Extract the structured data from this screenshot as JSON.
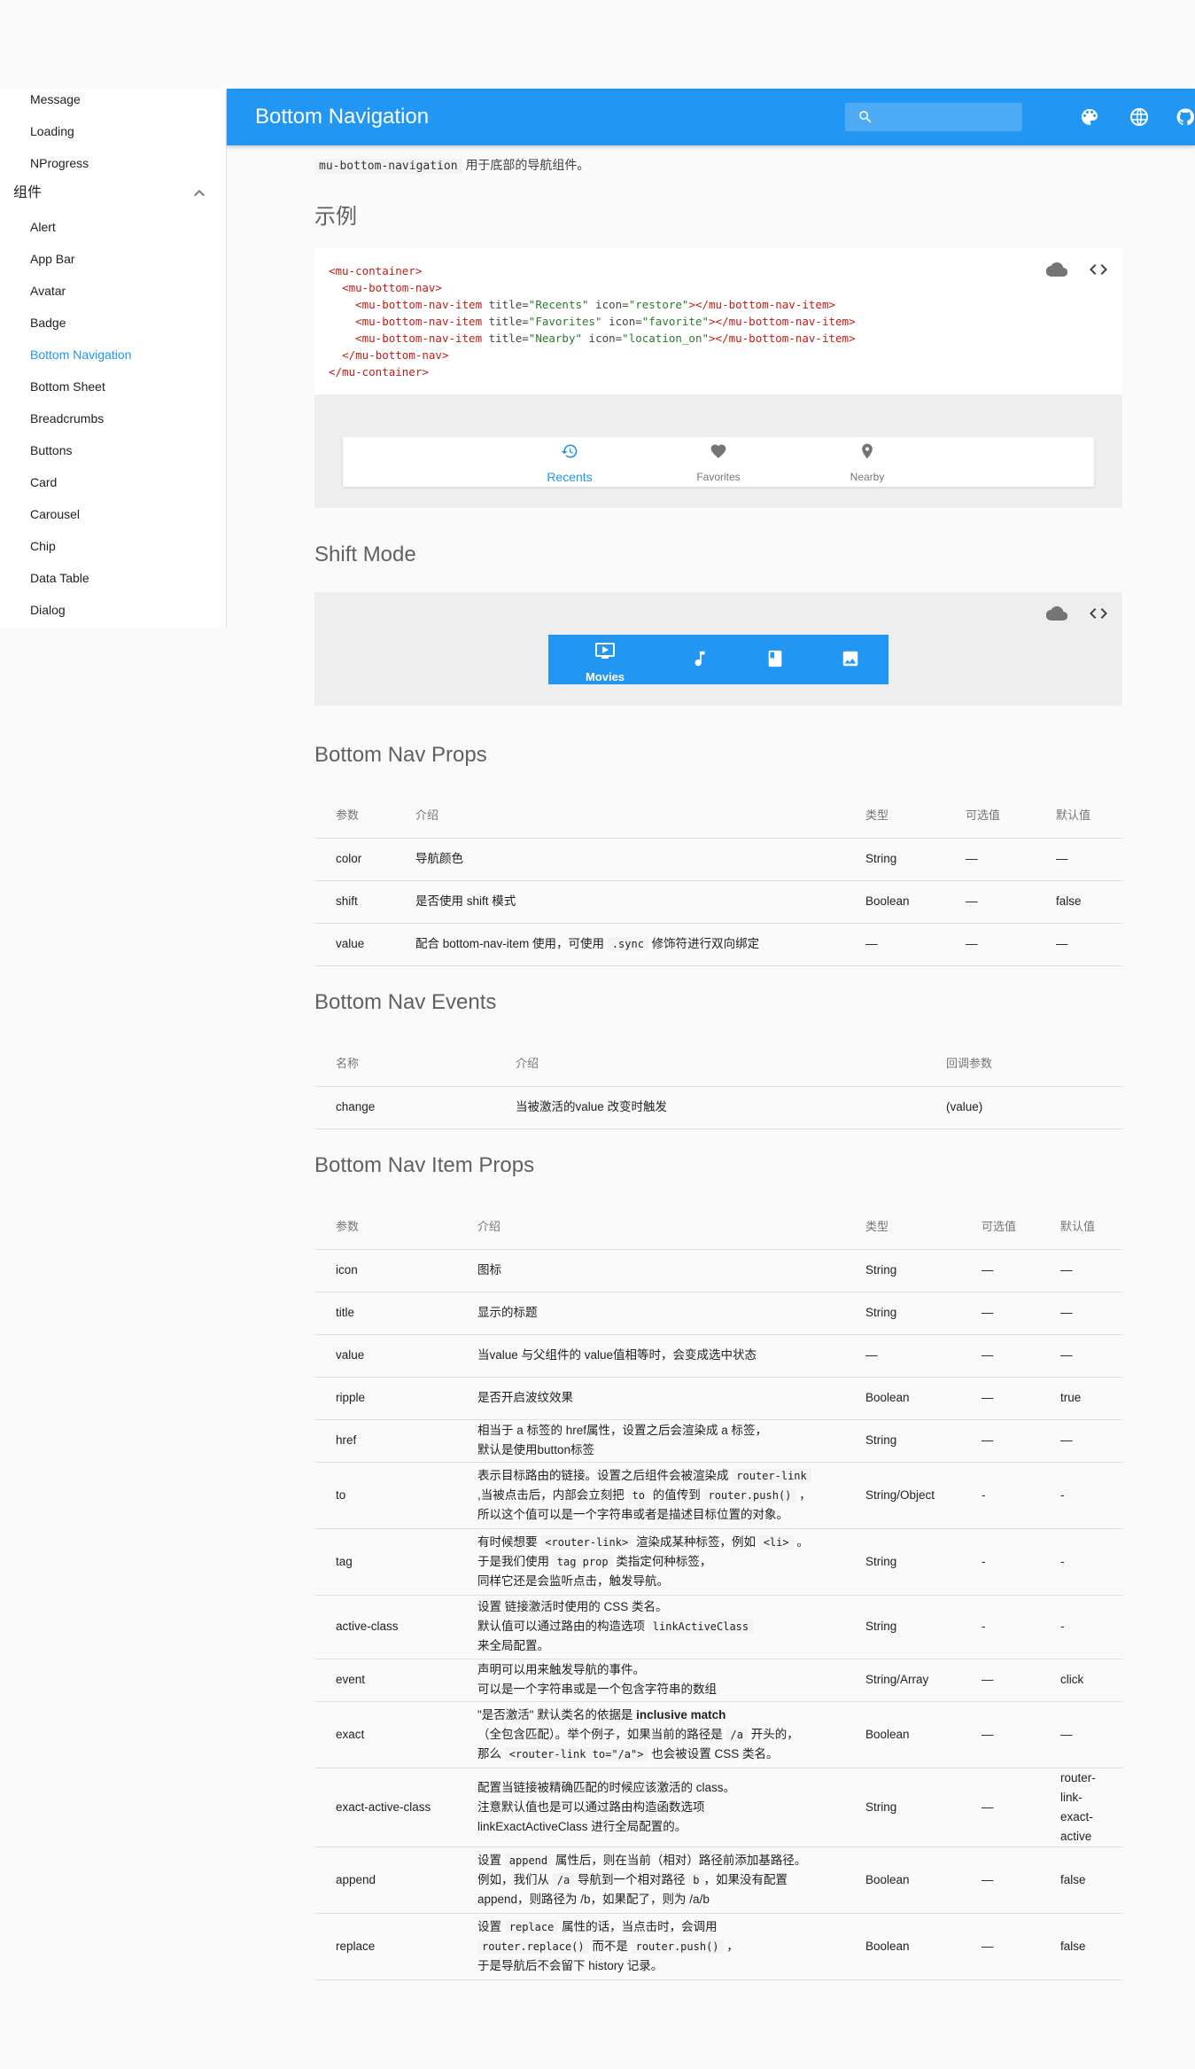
{
  "appbar": {
    "title": "Bottom Navigation",
    "search_placeholder": ""
  },
  "sidebar": {
    "items_top": [
      "Message",
      "Loading",
      "NProgress"
    ],
    "group_label": "组件",
    "items": [
      "Alert",
      "App Bar",
      "Avatar",
      "Badge",
      "Bottom Navigation",
      "Bottom Sheet",
      "Breadcrumbs",
      "Buttons",
      "Card",
      "Carousel",
      "Chip",
      "Data Table",
      "Dialog"
    ],
    "active_item": "Bottom Navigation"
  },
  "intro": {
    "code": "mu-bottom-navigation",
    "text": "用于底部的导航组件。"
  },
  "example": {
    "heading": "示例",
    "code_lines": [
      "<mu-container>",
      "  <mu-bottom-nav>",
      "    <mu-bottom-nav-item title=\"Recents\" icon=\"restore\"></mu-bottom-nav-item>",
      "    <mu-bottom-nav-item title=\"Favorites\" icon=\"favorite\"></mu-bottom-nav-item>",
      "    <mu-bottom-nav-item title=\"Nearby\" icon=\"location_on\"></mu-bottom-nav-item>",
      "  </mu-bottom-nav>",
      "</mu-container>"
    ],
    "nav_items": [
      {
        "label": "Recents",
        "icon": "restore-icon",
        "active": true
      },
      {
        "label": "Favorites",
        "icon": "favorite-icon",
        "active": false
      },
      {
        "label": "Nearby",
        "icon": "location-on-icon",
        "active": false
      }
    ]
  },
  "shift_mode": {
    "heading": "Shift Mode",
    "items": [
      {
        "label": "Movies",
        "icon": "ondemand-video-icon",
        "active": true
      },
      {
        "label": "",
        "icon": "music-note-icon",
        "active": false
      },
      {
        "label": "",
        "icon": "book-icon",
        "active": false
      },
      {
        "label": "",
        "icon": "photo-icon",
        "active": false
      }
    ]
  },
  "colors": {
    "primary": "#2196f3",
    "preview_bg": "#eeeeee"
  },
  "props_table": {
    "heading": "Bottom Nav Props",
    "headers": [
      "参数",
      "介绍",
      "类型",
      "可选值",
      "默认值"
    ],
    "rows": [
      [
        "color",
        "导航颜色",
        "String",
        "—",
        "—"
      ],
      [
        "shift",
        "是否使用 shift 模式",
        "Boolean",
        "—",
        "false"
      ],
      [
        "value",
        "配合 bottom-nav-item 使用，可使用 |.sync| 修饰符进行双向绑定",
        "—",
        "—",
        "—"
      ]
    ]
  },
  "events_table": {
    "heading": "Bottom Nav Events",
    "headers": [
      "名称",
      "介绍",
      "回调参数"
    ],
    "rows": [
      [
        "change",
        "当被激活的value 改变时触发",
        "(value)"
      ]
    ]
  },
  "item_props_table": {
    "heading": "Bottom Nav Item Props",
    "headers": [
      "参数",
      "介绍",
      "类型",
      "可选值",
      "默认值"
    ],
    "rows": [
      [
        "icon",
        "图标",
        "String",
        "—",
        "—"
      ],
      [
        "title",
        "显示的标题",
        "String",
        "—",
        "—"
      ],
      [
        "value",
        "当value 与父组件的 value值相等时，会变成选中状态",
        "—",
        "—",
        "—"
      ],
      [
        "ripple",
        "是否开启波纹效果",
        "Boolean",
        "—",
        "true"
      ],
      [
        "href",
        "相当于 a 标签的 href属性，设置之后会渲染成 a 标签，\n默认是使用button标签",
        "String",
        "—",
        "—"
      ],
      [
        "to",
        "表示目标路由的链接。设置之后组件会被渲染成 |router-link|\n,当被点击后，内部会立刻把 |to| 的值传到 |router.push()| ，\n所以这个值可以是一个字符串或者是描述目标位置的对象。",
        "String/Object",
        "-",
        "-"
      ],
      [
        "tag",
        "有时候想要 |<router-link>| 渲染成某种标签，例如 |<li>| 。\n于是我们使用 |tag prop| 类指定何种标签，\n同样它还是会监听点击，触发导航。",
        "String",
        "-",
        "-"
      ],
      [
        "active-class",
        "设置 链接激活时使用的 CSS 类名。\n默认值可以通过路由的构造选项 |linkActiveClass|\n来全局配置。",
        "String",
        "-",
        "-"
      ],
      [
        "event",
        "声明可以用来触发导航的事件。\n可以是一个字符串或是一个包含字符串的数组",
        "String/Array",
        "—",
        "click"
      ],
      [
        "exact",
        "\"是否激活\" 默认类名的依据是 **inclusive match**\n（全包含匹配）。举个例子，如果当前的路径是 |/a| 开头的，\n那么 |<router-link to=\"/a\">| 也会被设置 CSS 类名。",
        "Boolean",
        "—",
        "—"
      ],
      [
        "exact-active-class",
        "配置当链接被精确匹配的时候应该激活的 class。\n注意默认值也是可以通过路由构造函数选项\nlinkExactActiveClass 进行全局配置的。",
        "String",
        "—",
        "router-\nlink-\nexact-\nactive"
      ],
      [
        "append",
        "设置 |append| 属性后，则在当前（相对）路径前添加基路径。\n例如，我们从 |/a| 导航到一个相对路径 |b|，如果没有配置\nappend，则路径为 /b，如果配了，则为 /a/b",
        "Boolean",
        "—",
        "false"
      ],
      [
        "replace",
        "设置 |replace| 属性的话，当点击时，会调用\n|router.replace()| 而不是 |router.push()| ，\n于是导航后不会留下 history 记录。",
        "Boolean",
        "—",
        "false"
      ]
    ]
  }
}
